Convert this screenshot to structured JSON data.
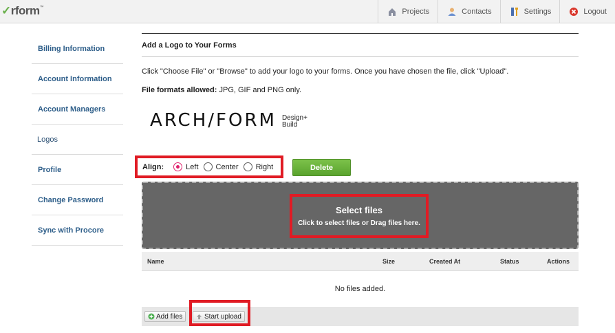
{
  "header": {
    "logo_text": "rform",
    "logo_tm": "™",
    "nav": [
      {
        "label": "Projects",
        "icon": "house-icon"
      },
      {
        "label": "Contacts",
        "icon": "person-icon"
      },
      {
        "label": "Settings",
        "icon": "tools-icon"
      },
      {
        "label": "Logout",
        "icon": "logout-icon"
      }
    ]
  },
  "sidebar": {
    "items": [
      {
        "label": "Billing Information"
      },
      {
        "label": "Account Information"
      },
      {
        "label": "Account Managers"
      },
      {
        "label": "Logos",
        "active": true
      },
      {
        "label": "Profile"
      },
      {
        "label": "Change Password"
      },
      {
        "label": "Sync with Procore"
      }
    ]
  },
  "main": {
    "title": "Add a Logo to Your Forms",
    "description": "Click \"Choose File\" or \"Browse\" to add your logo to your forms. Once you have chosen the file, click \"Upload\".",
    "formats_label": "File formats allowed:",
    "formats_value": "JPG, GIF and PNG only.",
    "logo_preview": {
      "main": "ARCH/FORM",
      "sub1": "Design+",
      "sub2": "Build"
    },
    "align": {
      "label": "Align:",
      "options": [
        {
          "label": "Left",
          "checked": true
        },
        {
          "label": "Center",
          "checked": false
        },
        {
          "label": "Right",
          "checked": false
        }
      ]
    },
    "delete_label": "Delete",
    "dropzone": {
      "title": "Select files",
      "subtitle": "Click to select files or Drag files here."
    },
    "table": {
      "columns": [
        "Name",
        "Size",
        "Created At",
        "Status",
        "Actions"
      ],
      "empty_text": "No files added."
    },
    "add_files_label": "Add files",
    "start_upload_label": "Start upload"
  },
  "colors": {
    "accent_green": "#5aa32e",
    "highlight_red": "#e01b24",
    "radio_pink": "#e0206c",
    "link_blue": "#2f5f8a"
  }
}
